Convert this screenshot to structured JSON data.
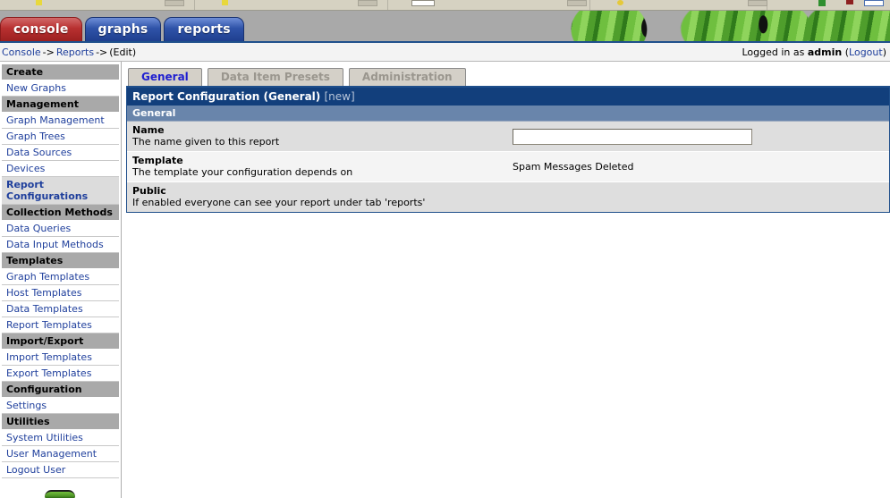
{
  "browser": {
    "chrome_visible": true
  },
  "nav_tabs": [
    {
      "label": "console",
      "color": "#b83030",
      "active": true
    },
    {
      "label": "graphs",
      "color": "#2f53a8",
      "active": false
    },
    {
      "label": "reports",
      "color": "#2f53a8",
      "active": false
    }
  ],
  "breadcrumb": {
    "items": [
      "Console",
      "Reports",
      "(Edit)"
    ],
    "separator": "->",
    "item0": "Console",
    "item1": "Reports",
    "item2": "(Edit)",
    "sep0": "->",
    "sep1": "->"
  },
  "session": {
    "prefix": "Logged in as",
    "user": "admin",
    "logout_open": "(",
    "logout_label": "Logout",
    "logout_close": ")"
  },
  "sidebar": {
    "groups": [
      {
        "header": "Create",
        "items": [
          {
            "label": "New Graphs",
            "active": false
          }
        ]
      },
      {
        "header": "Management",
        "items": [
          {
            "label": "Graph Management",
            "active": false
          },
          {
            "label": "Graph Trees",
            "active": false
          },
          {
            "label": "Data Sources",
            "active": false
          },
          {
            "label": "Devices",
            "active": false
          },
          {
            "label": "Report Configurations",
            "active": true
          }
        ]
      },
      {
        "header": "Collection Methods",
        "items": [
          {
            "label": "Data Queries",
            "active": false
          },
          {
            "label": "Data Input Methods",
            "active": false
          }
        ]
      },
      {
        "header": "Templates",
        "items": [
          {
            "label": "Graph Templates",
            "active": false
          },
          {
            "label": "Host Templates",
            "active": false
          },
          {
            "label": "Data Templates",
            "active": false
          },
          {
            "label": "Report Templates",
            "active": false
          }
        ]
      },
      {
        "header": "Import/Export",
        "items": [
          {
            "label": "Import Templates",
            "active": false
          },
          {
            "label": "Export Templates",
            "active": false
          }
        ]
      },
      {
        "header": "Configuration",
        "items": [
          {
            "label": "Settings",
            "active": false
          }
        ]
      },
      {
        "header": "Utilities",
        "items": [
          {
            "label": "System Utilities",
            "active": false
          },
          {
            "label": "User Management",
            "active": false
          },
          {
            "label": "Logout User",
            "active": false
          }
        ]
      }
    ],
    "logo_name": "cacti-logo"
  },
  "content": {
    "tabs": [
      {
        "label": "General",
        "active": true,
        "disabled": false
      },
      {
        "label": "Data Item Presets",
        "active": false,
        "disabled": true
      },
      {
        "label": "Administration",
        "active": false,
        "disabled": true
      }
    ],
    "form": {
      "title": "Report Configuration (General)",
      "state": "[new]",
      "section": "General",
      "rows": [
        {
          "label": "Name",
          "description": "The name given to this report",
          "control": "text",
          "value": "",
          "placeholder": ""
        },
        {
          "label": "Template",
          "description": "The template your configuration depends on",
          "control": "static",
          "value": "Spam Messages Deleted"
        },
        {
          "label": "Public",
          "description": "If enabled everyone can see your report under tab 'reports'",
          "control": "empty",
          "value": ""
        }
      ]
    }
  },
  "colors": {
    "title_bar": "#123f7c",
    "sub_bar": "#6985ab",
    "banner": "#a9a9a9",
    "link": "#1f3f9c",
    "menu_header": "#a9a9a9",
    "row_shade_a": "#dedede",
    "row_shade_b": "#f4f4f4",
    "accent_red": "#b83030",
    "accent_blue": "#2f53a8",
    "cactus_green": "#6fbf3f"
  }
}
